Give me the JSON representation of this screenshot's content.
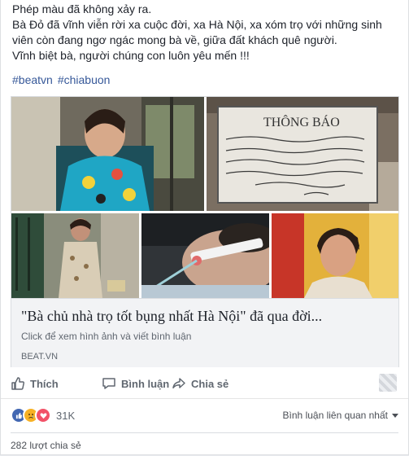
{
  "post": {
    "lines": [
      "Phép màu đã không xảy ra.",
      "Bà Đỏ đã vĩnh viễn rời xa cuộc đời, xa Hà Nội, xa xóm trọ với những sinh",
      "viên còn đang ngơ ngác mong bà về, giữa đất khách quê người.",
      "Vĩnh biệt bà, người chúng con luôn yêu mến !!!"
    ],
    "hashtags": [
      "#beatvn",
      "#chiabuon"
    ]
  },
  "link": {
    "title": "\"Bà chủ nhà trọ tốt bụng nhất Hà Nội\" đã qua đời...",
    "description": "Click để xem hình ảnh và viết bình luận",
    "domain": "BEAT.VN",
    "images": [
      "woman-smiling-photo",
      "notice-board-photo",
      "woman-cooking-photo",
      "hospital-patient-photo",
      "woman-portrait-photo"
    ],
    "notice_heading": "THÔNG BÁO"
  },
  "actions": {
    "like": "Thích",
    "comment": "Bình luận",
    "share": "Chia sẻ"
  },
  "stats": {
    "reaction_count": "31K",
    "sort_label": "Bình luận liên quan nhất",
    "shares": "282 lượt chia sẻ"
  },
  "colors": {
    "link": "#365899",
    "like": "#4267b2",
    "sad": "#f7b125",
    "love": "#f25268"
  }
}
